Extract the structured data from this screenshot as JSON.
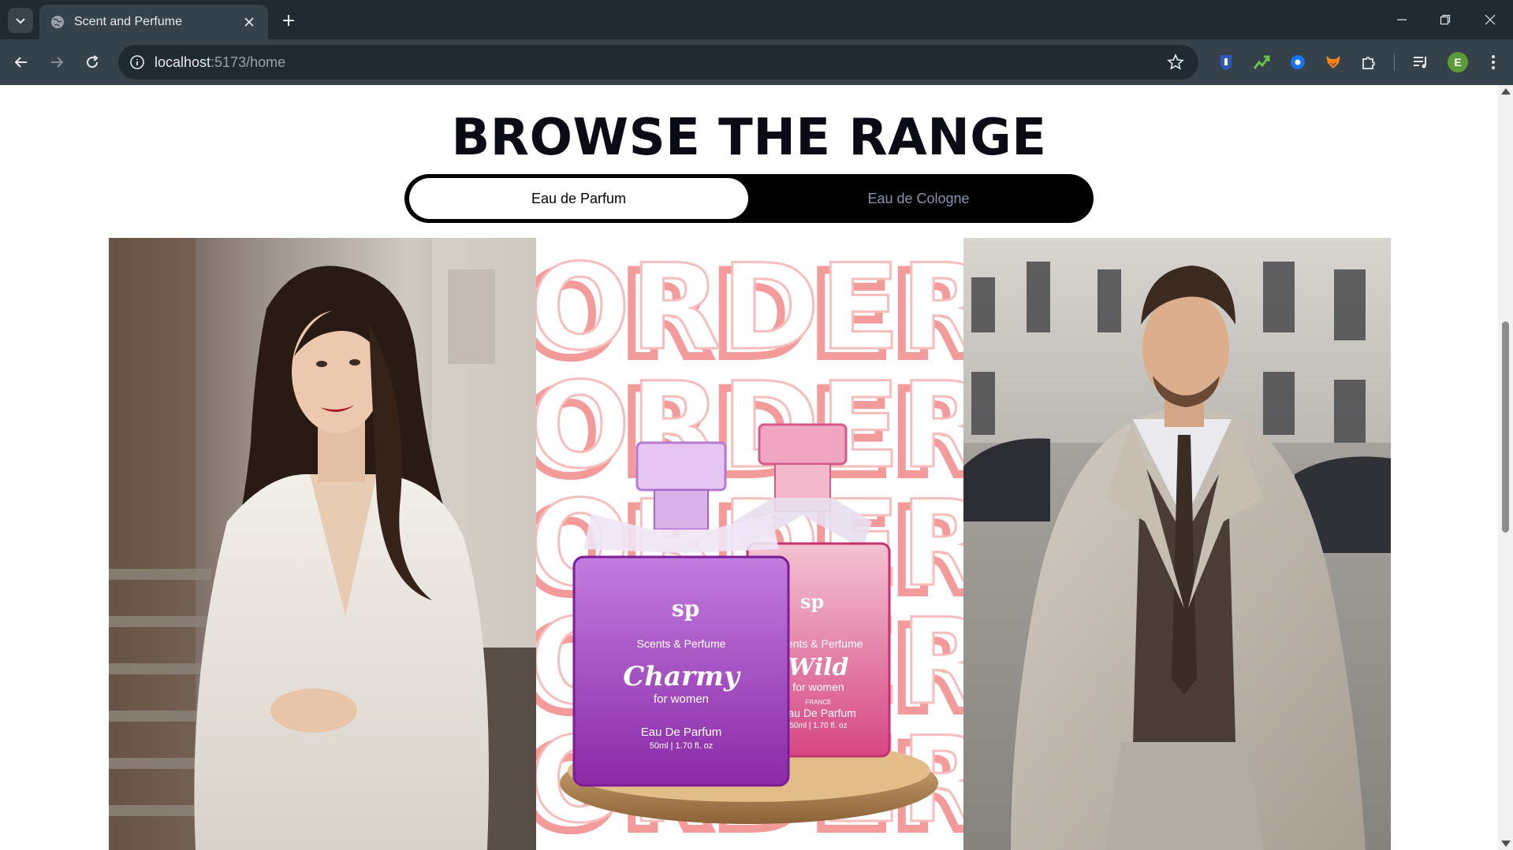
{
  "browser": {
    "tab_title": "Scent and Perfume",
    "url_host": "localhost",
    "url_path": ":5173/home",
    "profile_initial": "E"
  },
  "page": {
    "heading": "BROWSE THE RANGE",
    "toggle": {
      "active_label": "Eau de Parfum",
      "inactive_label": "Eau de Cologne"
    },
    "gallery": [
      {
        "subject": "woman in white lace dress"
      },
      {
        "subject": "perfume bottles",
        "background_word": "ORDER",
        "brand": "Scents & Perfume",
        "bottles": [
          {
            "name": "Charmy",
            "tagline": "for women",
            "type": "Eau De Parfum",
            "size": "50ml | 1.70 fl. oz"
          },
          {
            "name": "Wild",
            "tagline": "for women",
            "type": "Eau De Parfum",
            "size": "50ml | 1.70 fl. oz",
            "origin": "FRANCE"
          }
        ]
      },
      {
        "subject": "man in light grey suit"
      }
    ]
  },
  "colors": {
    "chrome_dark": "#202a33",
    "chrome_mid": "#35414b",
    "toggle_bg": "#000000",
    "toggle_inactive_text": "#8a93b5",
    "heading": "#0b0b16"
  }
}
